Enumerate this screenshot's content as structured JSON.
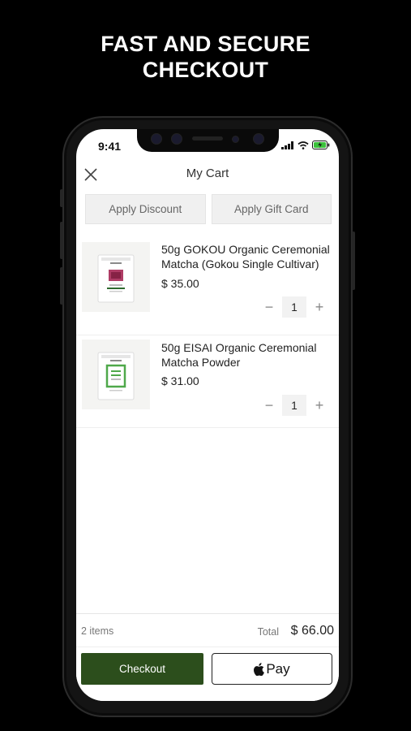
{
  "promo": {
    "line1": "FAST AND SECURE",
    "line2": "CHECKOUT"
  },
  "status_bar": {
    "time": "9:41",
    "icons": [
      "signal-icon",
      "wifi-icon",
      "battery-charging-icon"
    ]
  },
  "header": {
    "title": "My Cart",
    "close_icon": "close-icon"
  },
  "actions": {
    "discount_label": "Apply Discount",
    "giftcard_label": "Apply Gift Card"
  },
  "items": [
    {
      "name_line1": "50g GOKOU Organic Ceremonial",
      "name_line2": "Matcha (Gokou Single Cultivar)",
      "price": "$ 35.00",
      "qty": "1",
      "minus": "−",
      "plus": "+"
    },
    {
      "name_line1": "50g EISAI Organic Ceremonial",
      "name_line2": "Matcha Powder",
      "price": "$ 31.00",
      "qty": "1",
      "minus": "−",
      "plus": "+"
    }
  ],
  "summary": {
    "count": "2 items",
    "total_label": "Total",
    "total": "$ 66.00"
  },
  "buttons": {
    "checkout": "Checkout",
    "applepay": "Pay"
  },
  "colors": {
    "checkout": "#2c4e1c",
    "background": "#000000",
    "screen": "#ffffff",
    "pouch1_band": "#a11a4a",
    "pouch2_band": "#4fa84a"
  }
}
